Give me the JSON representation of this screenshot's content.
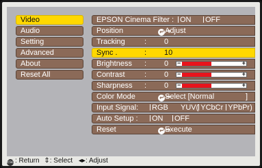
{
  "sidebar": {
    "items": [
      {
        "label": "Video"
      },
      {
        "label": "Audio"
      },
      {
        "label": "Setting"
      },
      {
        "label": "Advanced"
      },
      {
        "label": "About"
      },
      {
        "label": "Reset All"
      }
    ]
  },
  "panel": {
    "cinema_filter": {
      "label": "EPSON Cinema Filter :",
      "on": "ON",
      "off": "OFF"
    },
    "position": {
      "label": "Position",
      "action": "Adjust"
    },
    "tracking": {
      "label": "Tracking",
      "value": "0"
    },
    "sync": {
      "label": "Sync .",
      "value": "10"
    },
    "brightness": {
      "label": "Brightness",
      "value": "0",
      "level": 0.5
    },
    "contrast": {
      "label": "Contrast",
      "value": "0",
      "level": 0.5
    },
    "sharpness": {
      "label": "Sharpness",
      "value": "0",
      "level": 0.5
    },
    "color_mode": {
      "label": "Color Mode",
      "text": "Select [Normal",
      "close": "]"
    },
    "input_signal": {
      "label": "Input Signal:",
      "rgb": "RGB",
      "yuv_open": "YUV(",
      "ycbcr": "YCbCr",
      "ypbpr": "YPbPr)"
    },
    "auto_setup": {
      "label": "Auto Setup :",
      "on": "ON",
      "off": "OFF"
    },
    "reset": {
      "label": "Reset",
      "action": "Execute"
    },
    "colon": ":"
  },
  "footer": {
    "return": ": Return",
    "select": ": Select",
    "adjust": ": Adjust"
  }
}
